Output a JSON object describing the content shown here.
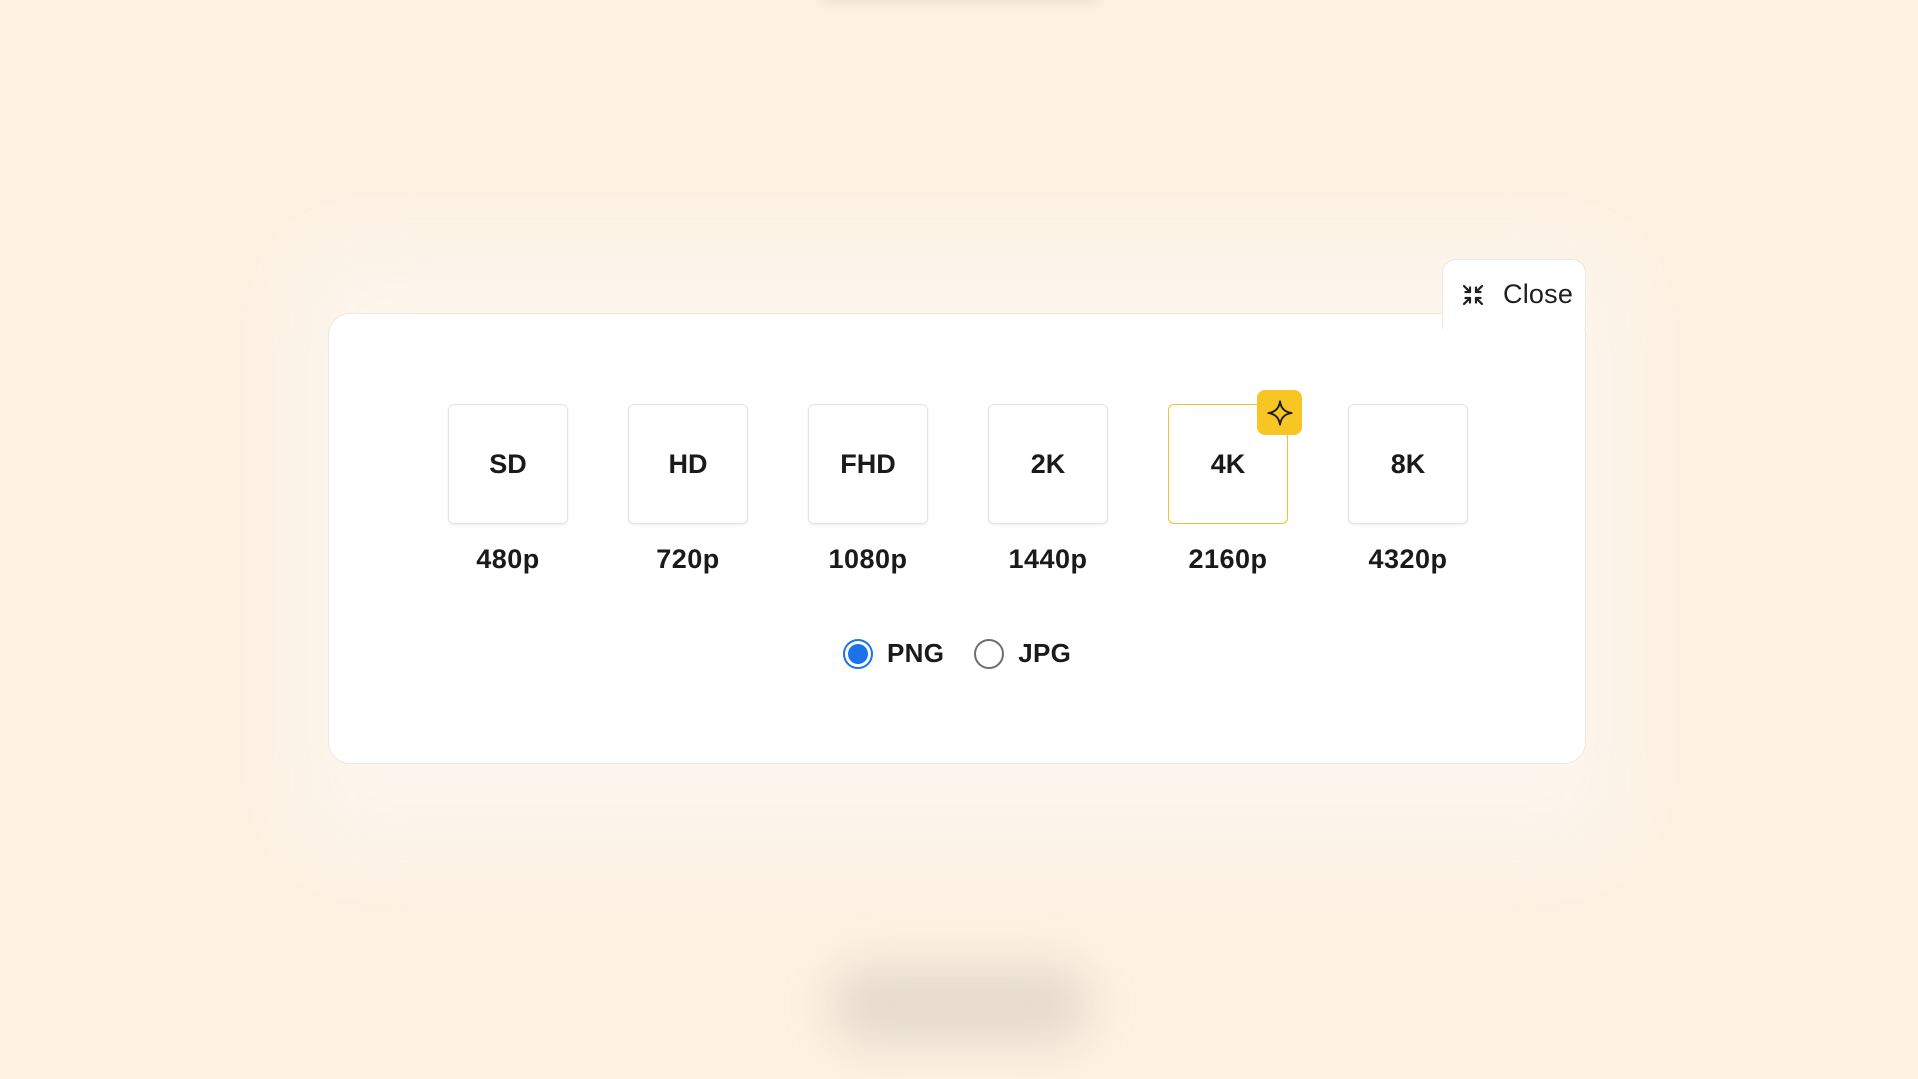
{
  "close_button": {
    "label": "Close",
    "icon": "collapse-icon"
  },
  "resolutions": [
    {
      "label": "SD",
      "value": "480p",
      "selected": false,
      "badge": false
    },
    {
      "label": "HD",
      "value": "720p",
      "selected": false,
      "badge": false
    },
    {
      "label": "FHD",
      "value": "1080p",
      "selected": false,
      "badge": false
    },
    {
      "label": "2K",
      "value": "1440p",
      "selected": false,
      "badge": false
    },
    {
      "label": "4K",
      "value": "2160p",
      "selected": true,
      "badge": true,
      "badge_icon": "sparkle-icon"
    },
    {
      "label": "8K",
      "value": "4320p",
      "selected": false,
      "badge": false
    }
  ],
  "formats": [
    {
      "label": "PNG",
      "checked": true
    },
    {
      "label": "JPG",
      "checked": false
    }
  ],
  "colors": {
    "background": "#fdf1e2",
    "accent_radio": "#1a73e8",
    "selected_border": "#f2c12e",
    "badge": "#f7c623"
  }
}
